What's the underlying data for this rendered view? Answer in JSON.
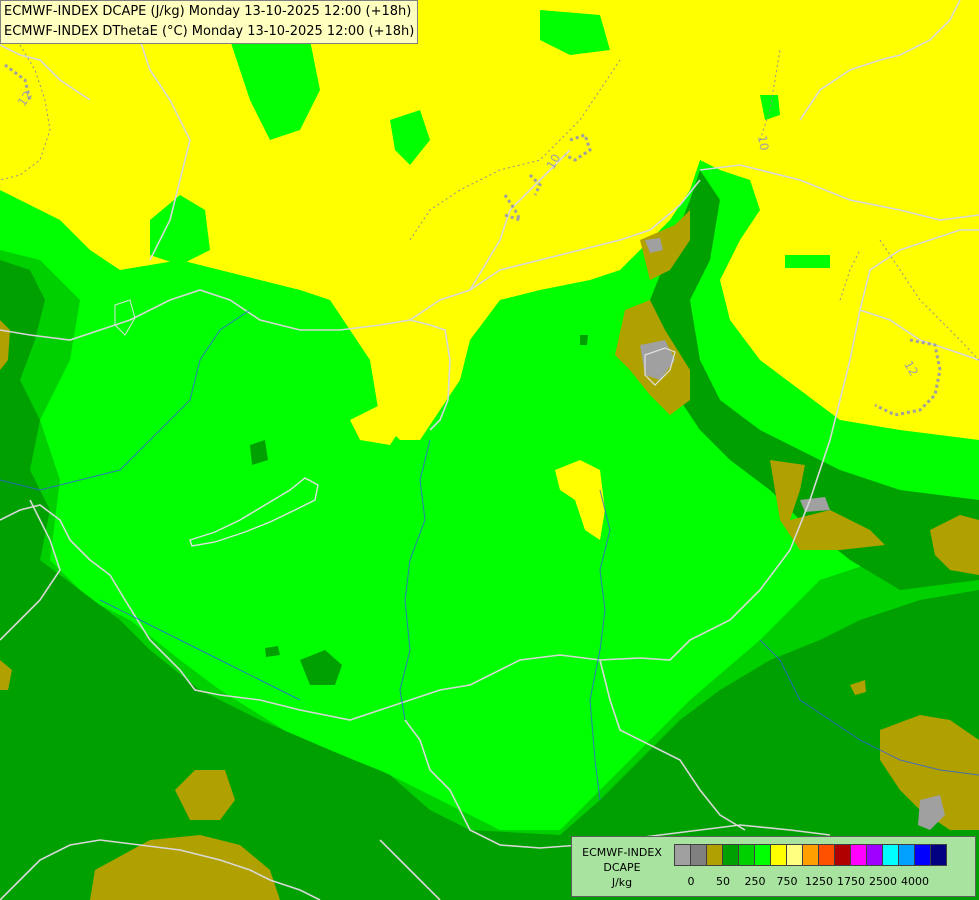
{
  "header": {
    "line1": "ECMWF-INDEX DCAPE (J/kg) Monday 13-10-2025 12:00 (+18h)",
    "line2": "ECMWF-INDEX DThetaE (°C) Monday 13-10-2025 12:00 (+18h)"
  },
  "legend": {
    "title1": "ECMWF-INDEX",
    "title2": "DCAPE",
    "unit": "J/kg",
    "colors": [
      "#a0a0a0",
      "#808080",
      "#b0a000",
      "#00a000",
      "#00d000",
      "#00ff00",
      "#ffff00",
      "#ffff80",
      "#ffa000",
      "#ff5000",
      "#b00000",
      "#ff00ff",
      "#a000ff",
      "#00ffff",
      "#00a0ff",
      "#0000ff",
      "#000080"
    ],
    "ticks": [
      "0",
      "50",
      "250",
      "750",
      "1250",
      "1750",
      "2500",
      "4000"
    ]
  },
  "contours": {
    "labels": [
      "12",
      "10",
      "10",
      "12"
    ]
  },
  "palette": {
    "yellow": "#ffff00",
    "light_green": "#00ff00",
    "mid_green": "#00d000",
    "dark_green": "#00a000",
    "olive": "#b0a000",
    "gray": "#a0a0a0"
  }
}
